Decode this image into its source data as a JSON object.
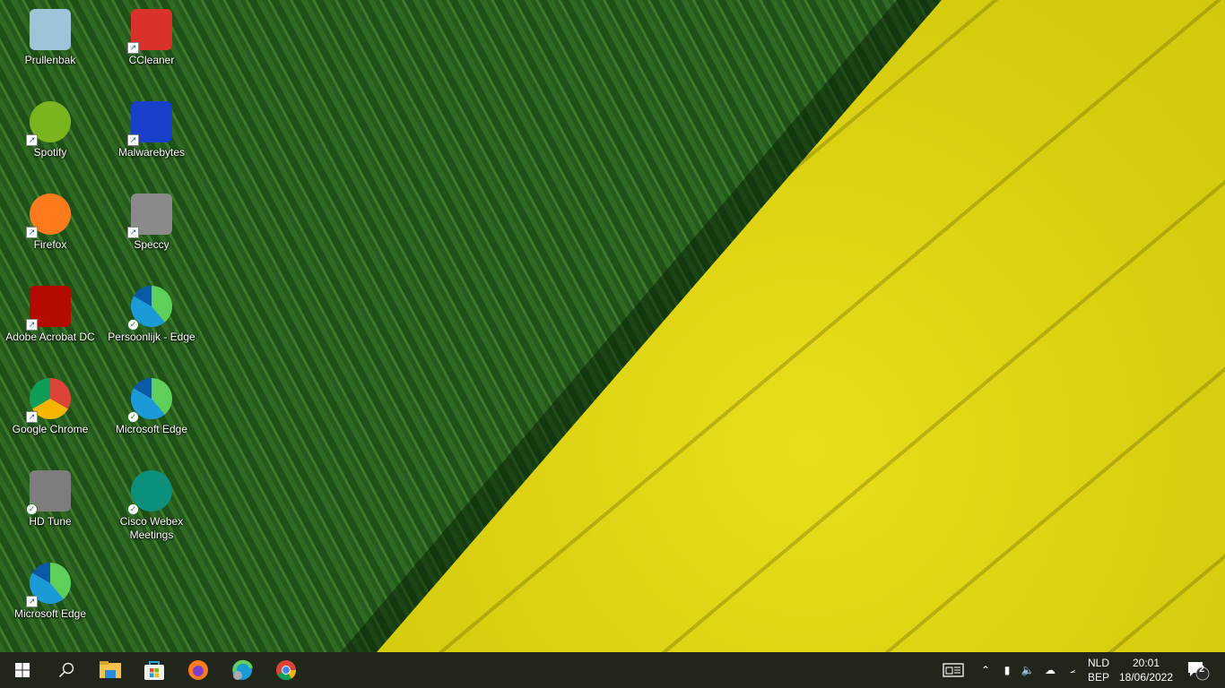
{
  "desktop_icons": [
    {
      "label": "Prullenbak",
      "icon": "recycle-bin-icon",
      "color": "#9fc3d9",
      "badge": "none"
    },
    {
      "label": "CCleaner",
      "icon": "ccleaner-icon",
      "color": "#d9322a",
      "badge": "shortcut"
    },
    {
      "label": "Spotify",
      "icon": "spotify-icon",
      "color": "#7ab51d",
      "badge": "shortcut"
    },
    {
      "label": "Malwarebytes",
      "icon": "malwarebytes-icon",
      "color": "#1a3fc9",
      "badge": "shortcut"
    },
    {
      "label": "Firefox",
      "icon": "firefox-icon",
      "color": "#ff7a1a",
      "badge": "shortcut"
    },
    {
      "label": "Speccy",
      "icon": "speccy-icon",
      "color": "#8a8a8a",
      "badge": "shortcut"
    },
    {
      "label": "Adobe Acrobat DC",
      "icon": "acrobat-icon",
      "color": "#b30b00",
      "badge": "shortcut"
    },
    {
      "label": "Persoonlijk - Edge",
      "icon": "edge-icon",
      "color": "#1a9bd7",
      "badge": "check"
    },
    {
      "label": "Google Chrome",
      "icon": "chrome-icon",
      "color": "#db4437",
      "badge": "shortcut"
    },
    {
      "label": "Microsoft Edge",
      "icon": "edge-icon",
      "color": "#1a9bd7",
      "badge": "check"
    },
    {
      "label": "HD Tune",
      "icon": "hdtune-icon",
      "color": "#7d7d7d",
      "badge": "check"
    },
    {
      "label": "Cisco Webex Meetings",
      "icon": "webex-icon",
      "color": "#0c8f7b",
      "badge": "check"
    },
    {
      "label": "Microsoft Edge",
      "icon": "edge-icon",
      "color": "#1a9bd7",
      "badge": "shortcut"
    }
  ],
  "taskbar": {
    "apps": [
      {
        "name": "start-button",
        "icon": "windows-icon"
      },
      {
        "name": "search-button",
        "icon": "search-icon"
      },
      {
        "name": "file-explorer",
        "icon": "folder-icon"
      },
      {
        "name": "microsoft-store",
        "icon": "store-icon"
      },
      {
        "name": "firefox",
        "icon": "firefox-icon"
      },
      {
        "name": "edge",
        "icon": "edge-icon"
      },
      {
        "name": "chrome",
        "icon": "chrome-icon"
      }
    ],
    "language_top": "NLD",
    "language_bottom": "BEP",
    "time": "20:01",
    "date": "18/06/2022",
    "notification_count": "2"
  }
}
